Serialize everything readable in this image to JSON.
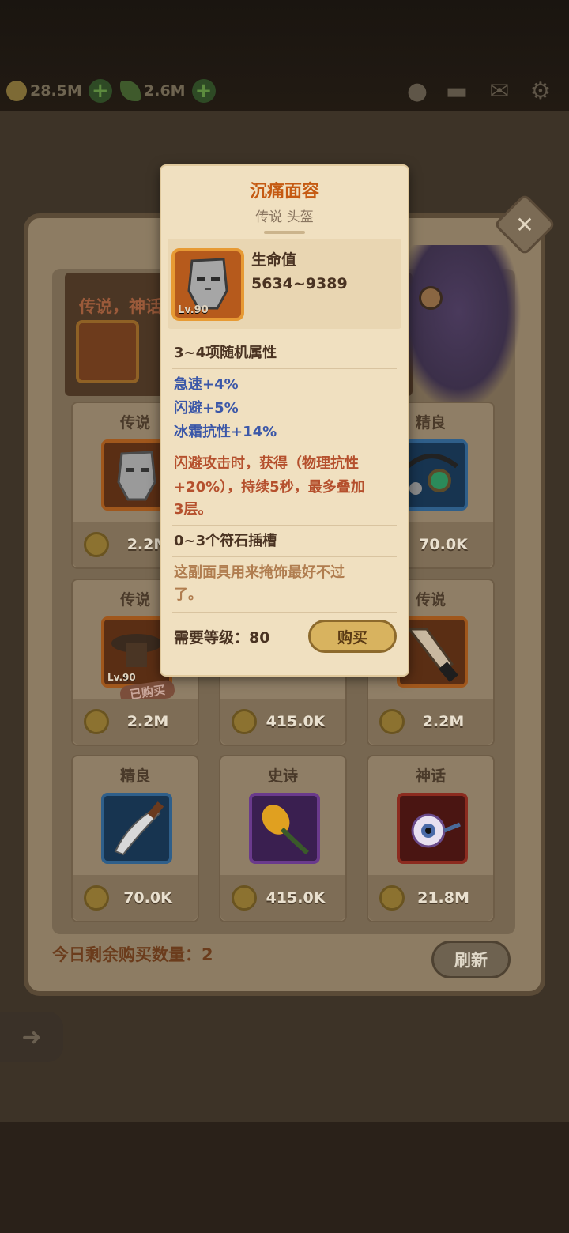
{
  "top": {
    "gold": "28.5M",
    "gems": "2.6M"
  },
  "shop": {
    "banner_text": "传说，神话",
    "remaining_label": "今日剩余购买数量：2",
    "refresh_label": "刷新",
    "cards": [
      {
        "rarity": "传说",
        "price": "2.2M",
        "icon": "mask-icon",
        "level": ""
      },
      {
        "rarity": "",
        "price": "",
        "icon": "",
        "level": ""
      },
      {
        "rarity": "精良",
        "price": "70.0K",
        "icon": "amulet-icon",
        "level": ""
      },
      {
        "rarity": "传说",
        "price": "2.2M",
        "icon": "hat-icon",
        "level": "Lv.90",
        "bought": "已购买"
      },
      {
        "rarity": "",
        "price": "415.0K",
        "icon": "boots-icon",
        "level": ""
      },
      {
        "rarity": "传说",
        "price": "2.2M",
        "icon": "blade-icon",
        "level": ""
      },
      {
        "rarity": "精良",
        "price": "70.0K",
        "icon": "knife-icon",
        "level": ""
      },
      {
        "rarity": "史诗",
        "price": "415.0K",
        "icon": "torch-icon",
        "level": ""
      },
      {
        "rarity": "神话",
        "price": "21.8M",
        "icon": "eye-icon",
        "level": ""
      }
    ]
  },
  "tooltip": {
    "title": "沉痛面容",
    "subtitle": "传说 头盔",
    "icon_level": "Lv.90",
    "stat_label": "生命值",
    "stat_value": "5634~9389",
    "random_attr_heading": "3~4项随机属性",
    "attrs": [
      "急速+4%",
      "闪避+5%",
      "冰霜抗性+14%"
    ],
    "effect_line1": "闪避攻击时，获得（物理抗性",
    "effect_line2": "+20%），持续5秒，最多叠加",
    "effect_line3": "3层。",
    "socket_heading": "0~3个符石插槽",
    "desc_line1": "这副面具用来掩饰最好不过",
    "desc_line2": "了。",
    "req_level": "需要等级：80",
    "buy_label": "购买"
  },
  "colors": {
    "title_orange": "#c55a12",
    "attr_blue": "#3b57a8",
    "effect_red": "#b5502d",
    "desc_brown": "#b07d4f"
  }
}
